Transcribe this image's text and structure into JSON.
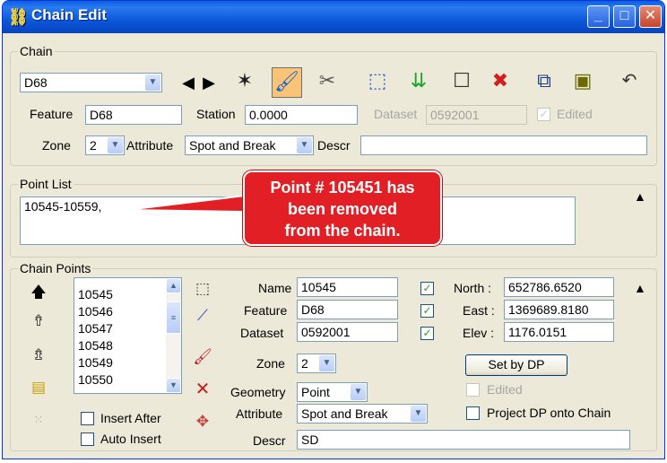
{
  "window": {
    "title": "Chain Edit",
    "title_icon": "chain-edit-app-icon"
  },
  "chain_group": {
    "label": "Chain",
    "chain_select": "D68",
    "feature_label": "Feature",
    "feature_value": "D68",
    "station_label": "Station",
    "station_value": "0.0000",
    "dataset_label": "Dataset",
    "dataset_value": "0592001",
    "edited_label": "Edited",
    "zone_label": "Zone",
    "zone_value": "2",
    "attribute_label": "Attribute",
    "attribute_value": "Spot and Break",
    "descr_label": "Descr",
    "descr_value": ""
  },
  "point_list_group": {
    "label": "Point List",
    "value": "10545-10559,"
  },
  "callout": {
    "line1": "Point # 105451 has",
    "line2": "been removed",
    "line3": "from the chain."
  },
  "chain_points_group": {
    "label": "Chain Points",
    "points": [
      "10545",
      "10546",
      "10547",
      "10548",
      "10549",
      "10550"
    ],
    "insert_after_label": "Insert After",
    "auto_insert_label": "Auto Insert",
    "name_label": "Name",
    "name_value": "10545",
    "feature_label": "Feature",
    "feature_value": "D68",
    "dataset_label": "Dataset",
    "dataset_value": "0592001",
    "zone_label": "Zone",
    "zone_value": "2",
    "geometry_label": "Geometry",
    "geometry_value": "Point",
    "attribute_label": "Attribute",
    "attribute_value": "Spot and Break",
    "descr_label": "Descr",
    "descr_value": "SD",
    "north_label": "North :",
    "north_value": "652786.6520",
    "east_label": "East :",
    "east_value": "1369689.8180",
    "elev_label": "Elev :",
    "elev_value": "1176.0151",
    "set_by_dp_label": "Set by DP",
    "edited_label": "Edited",
    "project_dp_label": "Project DP onto Chain"
  },
  "colors": {
    "titlebar": "#0b58db",
    "callout": "#e11f24",
    "check": "#21a121"
  }
}
